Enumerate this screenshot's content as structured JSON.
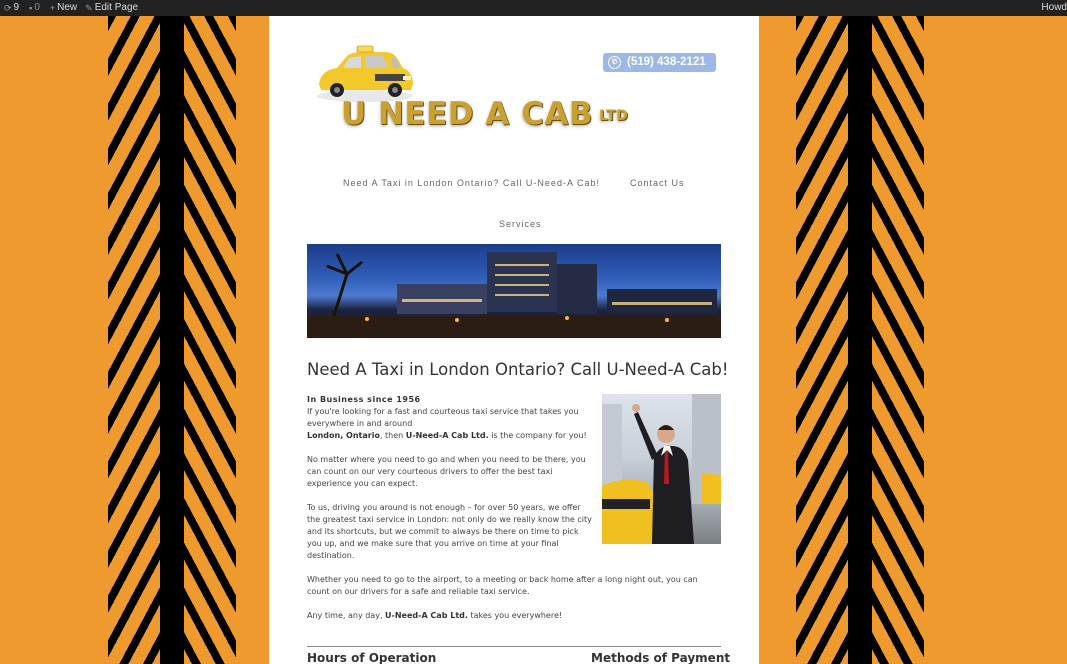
{
  "adminbar": {
    "updates_count": "9",
    "comments_count": "0",
    "new_label": "New",
    "edit_label": "Edit Page",
    "howdy_label": "Howd"
  },
  "site": {
    "logo_main": "U NEED A CAB",
    "logo_ltd": "LTD",
    "phone": "(519) 438-2121"
  },
  "nav": [
    "Need A Taxi in London Ontario? Call U-Need-A Cab!",
    "Contact Us",
    "Services"
  ],
  "page": {
    "title": "Need A Taxi in London Ontario? Call U-Need-A Cab!",
    "intro_strong": "In Business since 1956",
    "p1_a": "If you're looking for a fast and courteous taxi service that takes you everywhere in and around",
    "p1_city": "London, Ontario",
    "p1_b": ", then",
    "p1_company": "U-Need-A Cab Ltd.",
    "p1_c": "is the company for you!",
    "p2": "No matter where you need to go and when you need to be there, you can count on our very courteous drivers to offer the best taxi experience you can expect.",
    "p3": "To us, driving you around is not enough – for over 50 years, we offer the greatest taxi service in London: not only do we really know the city and its shortcuts, but we commit to always be there on time to pick you up, and we make sure that you arrive on time at your final destination.",
    "p4": "Whether you need to go to the airport, to a meeting or back home after a long night out, you can count on our drivers for a safe and reliable taxi service.",
    "p5_a": "Any time, any day,",
    "p5_company": "U-Need-A Cab Ltd.",
    "p5_b": "takes you everywhere!",
    "hours_heading": "Hours of Operation",
    "payment_heading": "Methods of Payment"
  },
  "colors": {
    "background": "#ee9a2f",
    "adminbar": "#222222",
    "phone_badge": "#9cb8e8",
    "logo_gold": "#c9a032"
  }
}
